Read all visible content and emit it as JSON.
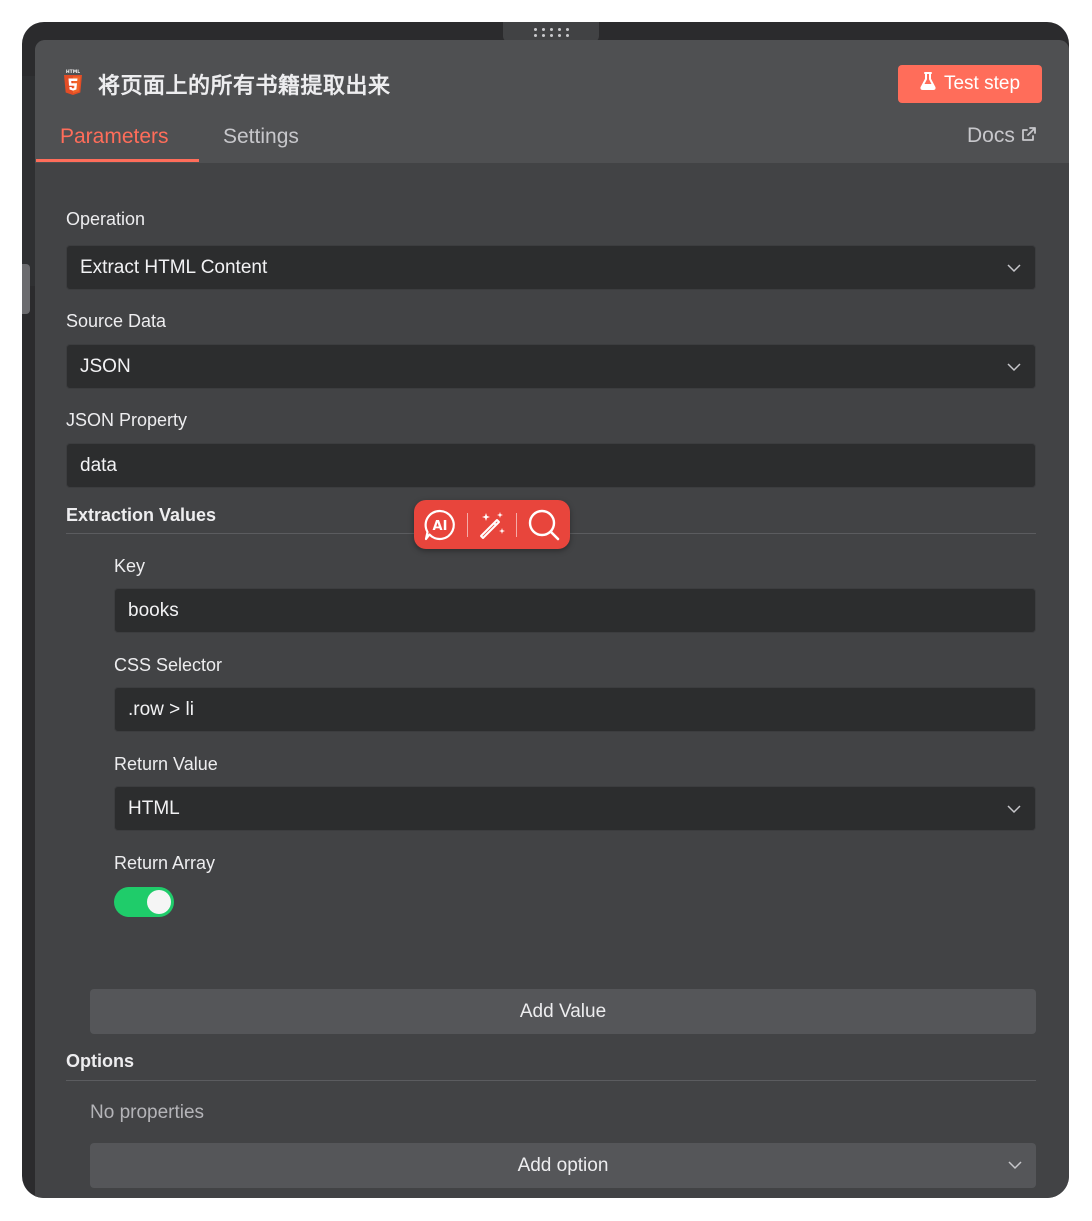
{
  "node": {
    "title": "将页面上的所有书籍提取出来",
    "icon": "html5-icon",
    "test_label": "Test step"
  },
  "tabs": [
    {
      "label": "Parameters",
      "active": true
    },
    {
      "label": "Settings",
      "active": false
    }
  ],
  "docs_label": "Docs",
  "fields": {
    "operation": {
      "label": "Operation",
      "value": "Extract HTML Content"
    },
    "source_data": {
      "label": "Source Data",
      "value": "JSON"
    },
    "json_property": {
      "label": "JSON Property",
      "value": "data"
    }
  },
  "extraction": {
    "title": "Extraction Values",
    "key": {
      "label": "Key",
      "value": "books"
    },
    "css_selector": {
      "label": "CSS Selector",
      "value": ".row > li"
    },
    "return_value": {
      "label": "Return Value",
      "value": "HTML"
    },
    "return_array": {
      "label": "Return Array",
      "enabled": true
    },
    "add_value_label": "Add Value"
  },
  "options": {
    "title": "Options",
    "empty_text": "No properties",
    "add_option_label": "Add option"
  },
  "ai_toolbar": {
    "icons": [
      "ai-chat-icon",
      "magic-wand-icon",
      "search-icon"
    ]
  },
  "colors": {
    "accent": "#ff6d5a",
    "toggle_on": "#1fcc6a",
    "ai_toolbar": "#e8453c"
  }
}
